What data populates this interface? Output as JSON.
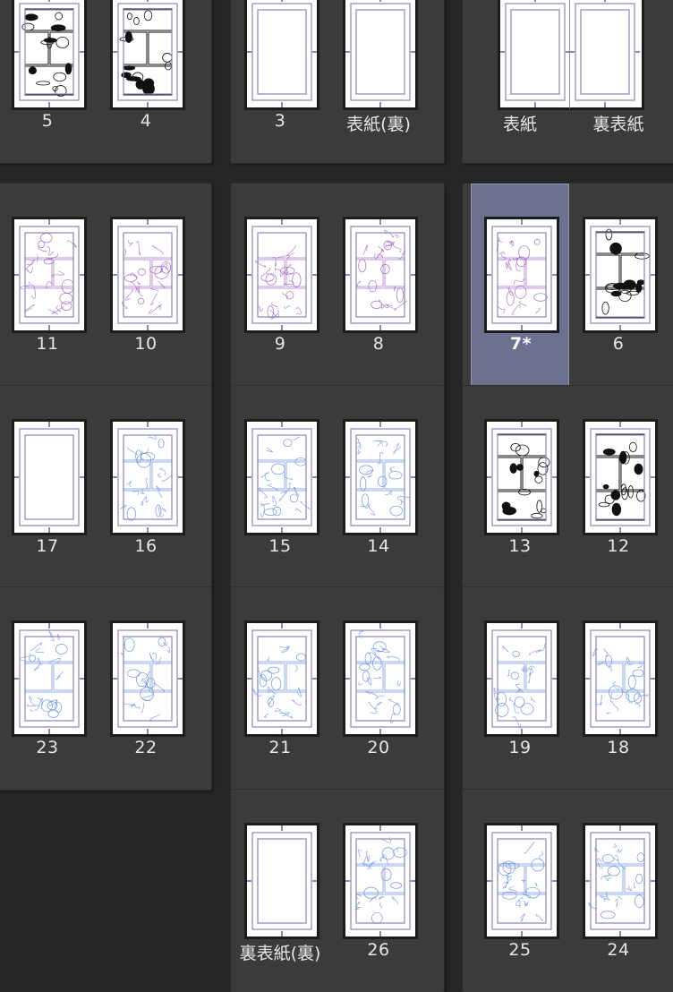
{
  "rows": [
    {
      "spreads": [
        {
          "pages": [
            {
              "label": "5",
              "style": "ink"
            },
            {
              "label": "4",
              "style": "ink"
            }
          ]
        },
        {
          "pages": [
            {
              "label": "3",
              "style": "blank"
            },
            {
              "label": "表紙(裏)",
              "style": "blank"
            }
          ]
        },
        {
          "pages": [
            {
              "label": "表紙",
              "style": "blank"
            },
            {
              "label": "裏表紙",
              "style": "blank"
            }
          ],
          "cover": true
        }
      ]
    },
    {
      "spreads": [
        {
          "pages": [
            {
              "label": "11",
              "style": "purple"
            },
            {
              "label": "10",
              "style": "purple"
            }
          ]
        },
        {
          "pages": [
            {
              "label": "9",
              "style": "purple"
            },
            {
              "label": "8",
              "style": "purple"
            }
          ]
        },
        {
          "pages": [
            {
              "label": "7*",
              "style": "purple",
              "selected": true
            },
            {
              "label": "6",
              "style": "ink"
            }
          ]
        }
      ]
    },
    {
      "spreads": [
        {
          "pages": [
            {
              "label": "17",
              "style": "blank"
            },
            {
              "label": "16",
              "style": "blue"
            }
          ]
        },
        {
          "pages": [
            {
              "label": "15",
              "style": "blue"
            },
            {
              "label": "14",
              "style": "blue"
            }
          ]
        },
        {
          "pages": [
            {
              "label": "13",
              "style": "ink"
            },
            {
              "label": "12",
              "style": "ink"
            }
          ]
        }
      ]
    },
    {
      "spreads": [
        {
          "pages": [
            {
              "label": "23",
              "style": "blue"
            },
            {
              "label": "22",
              "style": "blue"
            }
          ]
        },
        {
          "pages": [
            {
              "label": "21",
              "style": "blue"
            },
            {
              "label": "20",
              "style": "blue"
            }
          ]
        },
        {
          "pages": [
            {
              "label": "19",
              "style": "blue"
            },
            {
              "label": "18",
              "style": "blue"
            }
          ]
        }
      ]
    },
    {
      "spreads": [
        null,
        {
          "pages": [
            {
              "label": "裏表紙(裏)",
              "style": "blank"
            },
            {
              "label": "26",
              "style": "blue"
            }
          ]
        },
        {
          "pages": [
            {
              "label": "25",
              "style": "blue"
            },
            {
              "label": "24",
              "style": "blue"
            }
          ]
        }
      ]
    }
  ],
  "colors": {
    "background": "#262626",
    "spread": "#3b3b3b",
    "selected": "#6c7190",
    "frame": "#8a86b8",
    "ink": "#111111",
    "purple": "#a66bc6",
    "blue": "#6f93e0"
  }
}
